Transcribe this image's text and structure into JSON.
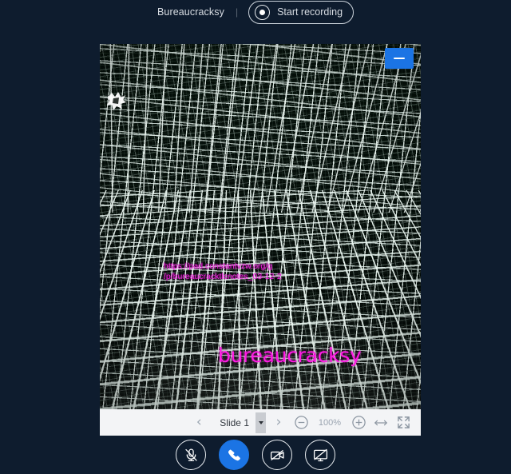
{
  "header": {
    "room_title": "Bureaucracksy",
    "separator": "|",
    "record_button_label": "Start recording",
    "record_icon": "record-dot-icon"
  },
  "slide": {
    "action_button_icon": "minus-icon",
    "doodle_icon": "white-scribble-mark",
    "overlay_url_line1": "https://pad.constantvzw.org/g",
    "overlay_url_line2": "/p/bureaucracktlcnotes_03-12-2",
    "overlay_wordmark": "bureaucracksy",
    "overlay_text_color": "#ff1ae4",
    "background": "warped white grid mesh on dark background"
  },
  "toolbar": {
    "prev_slide_icon": "chevron-left-icon",
    "prev_slide_label": "‹",
    "slide_select_value": "Slide 1",
    "slide_select_options": [
      "Slide 1"
    ],
    "next_slide_icon": "chevron-right-icon",
    "next_slide_label": "›",
    "zoom_out_icon": "minus-circle-icon",
    "zoom_level": "100%",
    "zoom_in_icon": "plus-circle-icon",
    "fit_width_icon": "arrows-horizontal-icon",
    "fullscreen_icon": "expand-icon"
  },
  "controls": {
    "accent_color": "#1b74e4",
    "items": [
      {
        "name": "microphone-muted-button",
        "icon": "microphone-slash-icon",
        "primary": false
      },
      {
        "name": "leave-audio-button",
        "icon": "phone-icon",
        "primary": true
      },
      {
        "name": "camera-off-button",
        "icon": "video-slash-icon",
        "primary": false
      },
      {
        "name": "screenshare-off-button",
        "icon": "desktop-slash-icon",
        "primary": false
      }
    ]
  },
  "theme": {
    "background": "#0e1c2e",
    "toolbar_background": "#f3f4f6"
  }
}
